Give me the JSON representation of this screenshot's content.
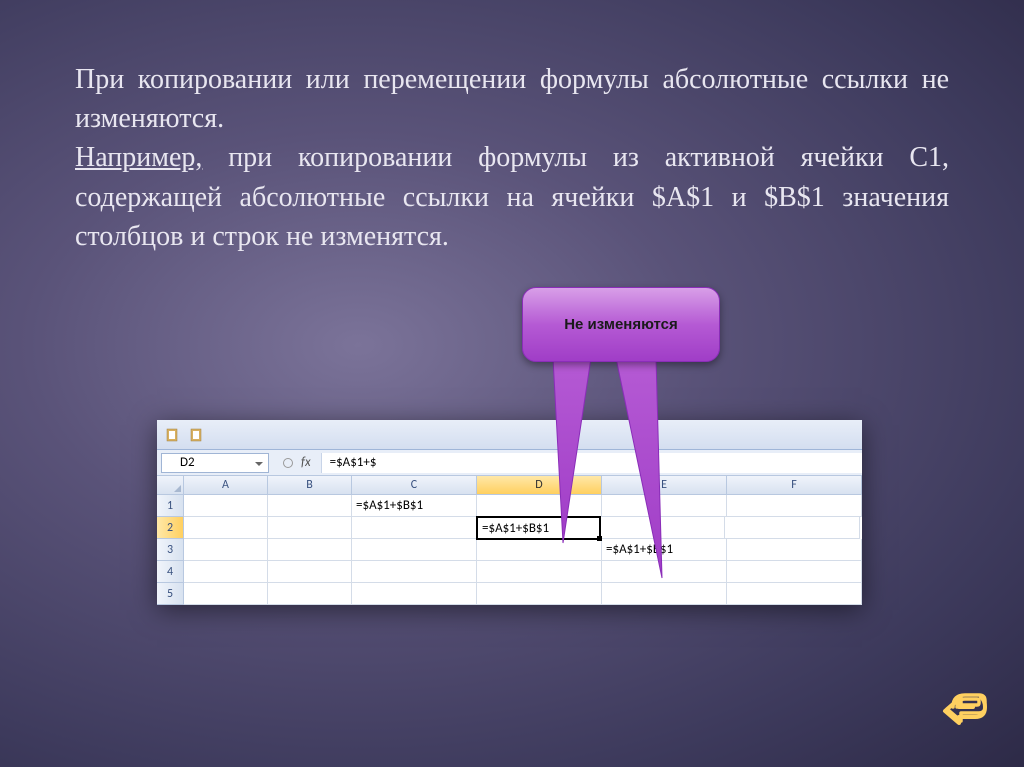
{
  "slide": {
    "paragraph1": "При копировании или перемещении формулы абсолютные ссылки не  изменяются.",
    "paragraph2_prefix": " Например,",
    "paragraph2_rest": " при  копировании формулы из активной ячейки С1, содержащей абсолютные ссылки на ячейки $А$1  и $В$1 значения столбцов и строк не изменятся."
  },
  "callout": {
    "text": "Не изменяются"
  },
  "excel": {
    "name_box": "D2",
    "formula_bar": "=$A$1+$",
    "fx_label": "fx",
    "columns": [
      "A",
      "B",
      "C",
      "D",
      "E",
      "F"
    ],
    "active_column": "D",
    "rows": [
      "1",
      "2",
      "3",
      "4",
      "5"
    ],
    "active_row": "2",
    "cells": {
      "C1": "=$A$1+$B$1",
      "D2": "=$A$1+$B$1",
      "E3": "=$A$1+$B$1"
    }
  }
}
